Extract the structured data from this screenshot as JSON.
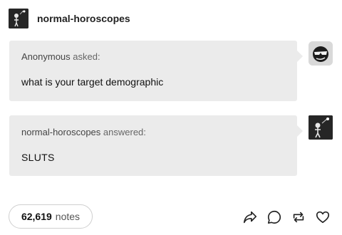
{
  "post": {
    "blog_name": "normal-horoscopes"
  },
  "ask": {
    "asker": "Anonymous",
    "asked_label": "asked:",
    "question": "what is your target demographic"
  },
  "answer": {
    "answerer": "normal-horoscopes",
    "answered_label": "answered:",
    "text": "SLUTS"
  },
  "footer": {
    "notes_count": "62,619",
    "notes_label": "notes",
    "actions": [
      "share-icon",
      "reply-icon",
      "reblog-icon",
      "like-icon"
    ]
  }
}
